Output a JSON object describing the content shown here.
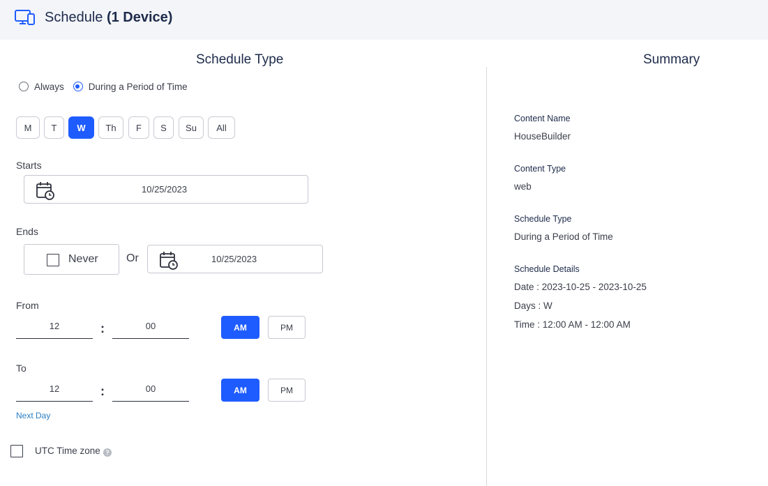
{
  "header": {
    "title_prefix": "Schedule",
    "title_count": "(1 Device)",
    "icon": "devices-icon"
  },
  "schedule_type": {
    "heading": "Schedule Type",
    "options": [
      {
        "label": "Always",
        "selected": false
      },
      {
        "label": "During a Period of Time",
        "selected": true
      }
    ],
    "days": [
      {
        "label": "M",
        "selected": false
      },
      {
        "label": "T",
        "selected": false
      },
      {
        "label": "W",
        "selected": true
      },
      {
        "label": "Th",
        "selected": false
      },
      {
        "label": "F",
        "selected": false
      },
      {
        "label": "S",
        "selected": false
      },
      {
        "label": "Su",
        "selected": false
      },
      {
        "label": "All",
        "selected": false
      }
    ],
    "starts": {
      "label": "Starts",
      "date": "10/25/2023",
      "icon": "calendar-clock-icon"
    },
    "ends": {
      "label": "Ends",
      "never_label": "Never",
      "never_checked": false,
      "or_label": "Or",
      "date": "10/25/2023",
      "icon": "calendar-clock-icon"
    },
    "from": {
      "label": "From",
      "hour": "12",
      "minute": "00",
      "separator": ":",
      "am": "AM",
      "pm": "PM",
      "period": "AM"
    },
    "to": {
      "label": "To",
      "hour": "12",
      "minute": "00",
      "separator": ":",
      "am": "AM",
      "pm": "PM",
      "period": "AM"
    },
    "next_day_link": "Next Day",
    "utc": {
      "label": "UTC Time zone",
      "checked": false,
      "help_icon": "question-circle-icon",
      "help_glyph": "?"
    }
  },
  "summary": {
    "heading": "Summary",
    "content_name_key": "Content Name",
    "content_name_value": "HouseBuilder",
    "content_type_key": "Content Type",
    "content_type_value": "web",
    "schedule_type_key": "Schedule Type",
    "schedule_type_value": "During a Period of Time",
    "details_key": "Schedule Details",
    "details_date": "Date : 2023-10-25 - 2023-10-25",
    "details_days": "Days : W",
    "details_time": "Time : 12:00 AM - 12:00 AM"
  },
  "colors": {
    "accent": "#1f5cff",
    "header_bg": "#f3f5f9",
    "link": "#2a7fc4",
    "heading_text": "#1d2a4a"
  }
}
